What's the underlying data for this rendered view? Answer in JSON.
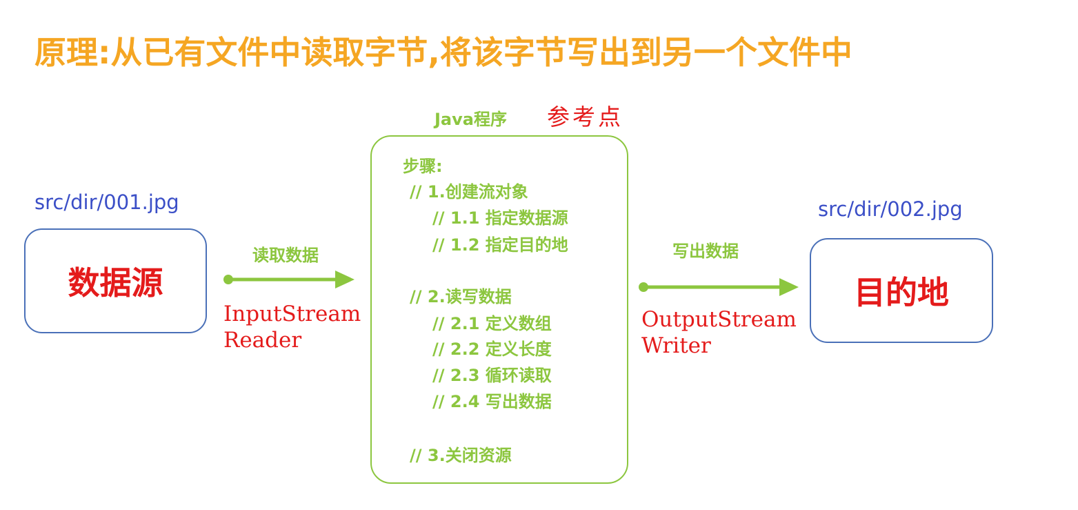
{
  "title": "原理:从已有文件中读取字节,将该字节写出到另一个文件中",
  "source": {
    "path": "src/dir/001.jpg",
    "label": "数据源"
  },
  "destination": {
    "path": "src/dir/002.jpg",
    "label": "目的地"
  },
  "read_arrow": {
    "label": "读取数据",
    "classes": [
      "InputStream",
      "Reader"
    ]
  },
  "write_arrow": {
    "label": "写出数据",
    "classes": [
      "OutputStream",
      "Writer"
    ]
  },
  "program": {
    "title": "Java程序",
    "annotation": "参考点",
    "steps_header": "步骤:",
    "steps": [
      "// 1.创建流对象",
      "// 1.1 指定数据源",
      "// 1.2 指定目的地",
      "// 2.读写数据",
      "// 2.1 定义数组",
      "// 2.2 定义长度",
      "// 2.3 循环读取",
      "// 2.4 写出数据",
      "// 3.关闭资源"
    ]
  },
  "colors": {
    "title": "#f5a623",
    "path": "#3b4fc7",
    "box_border": "#4a70b8",
    "box_text": "#e41b1b",
    "green": "#8cc63f",
    "red_annotation": "#e41b1b"
  }
}
